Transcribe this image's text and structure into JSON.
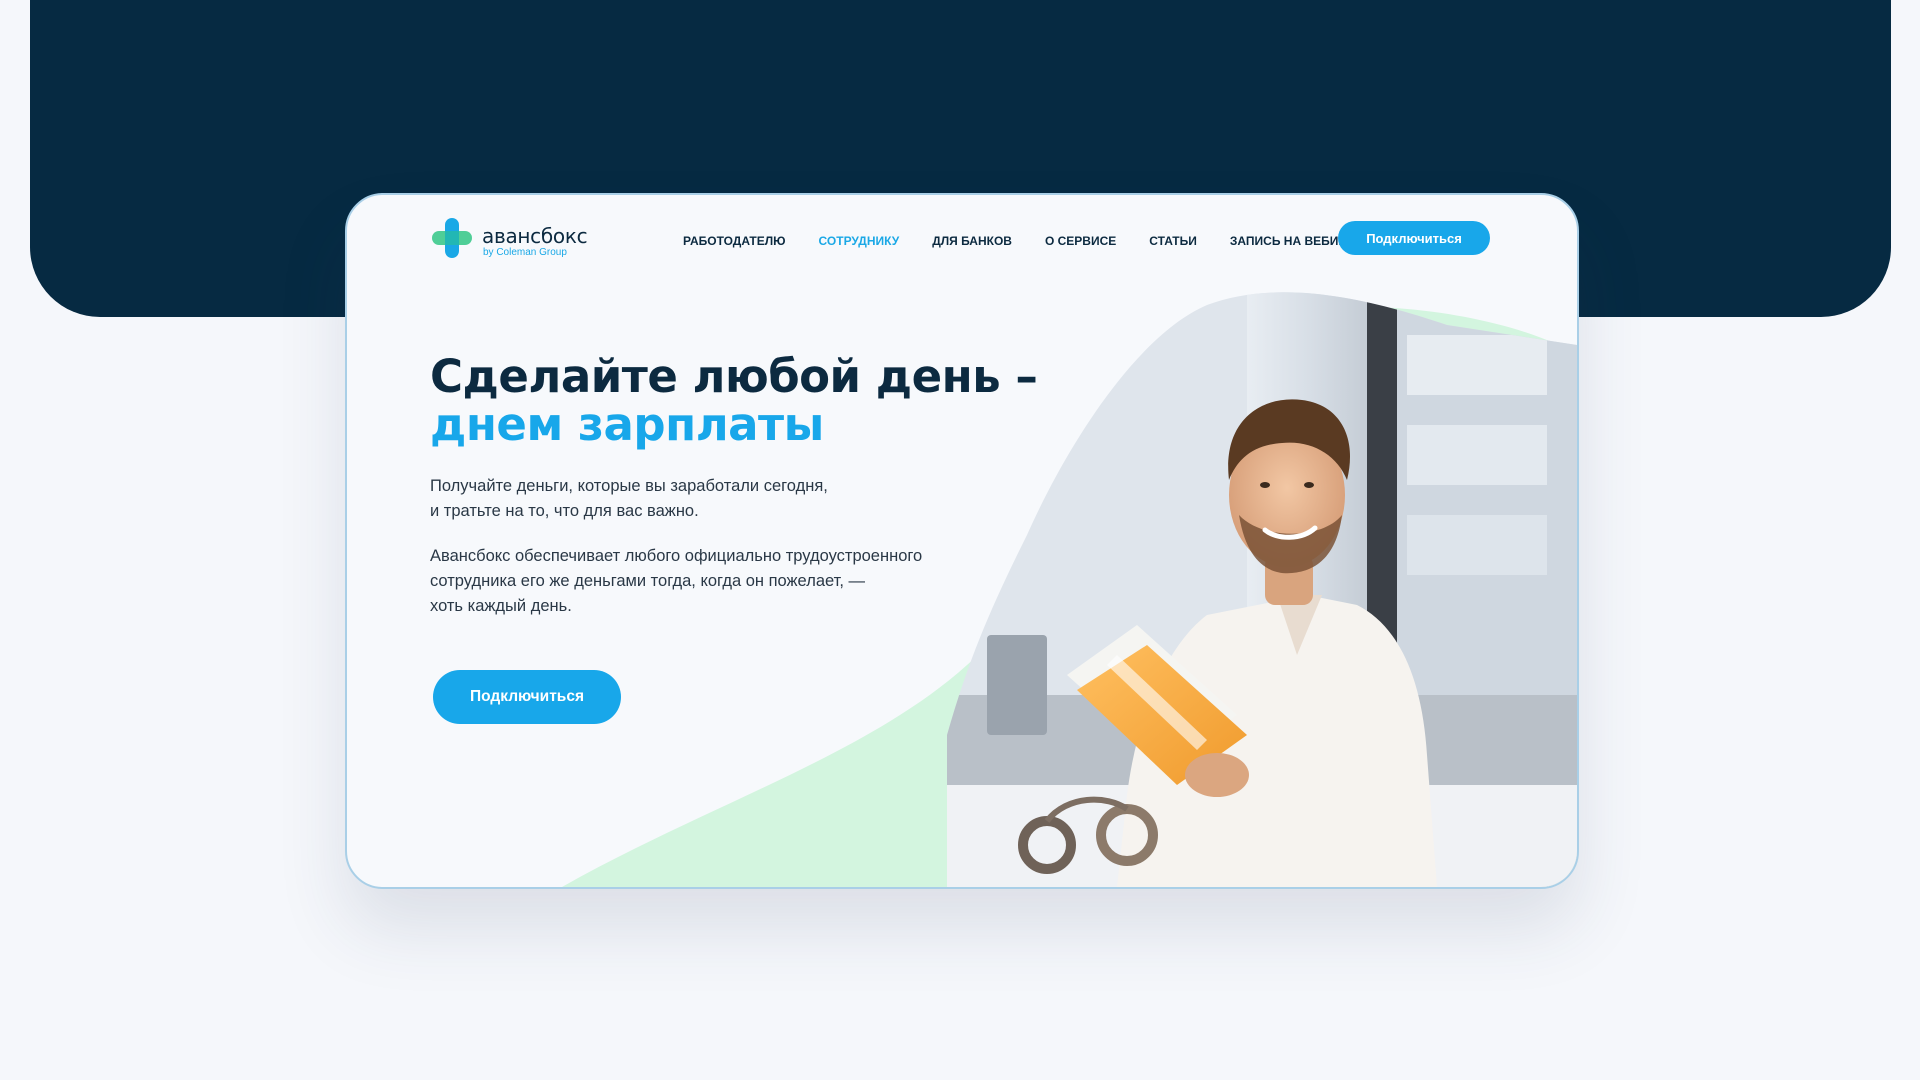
{
  "brand": {
    "name": "авансбокс",
    "byline": "by Coleman Group",
    "colors": {
      "dark_navy": "#062a42",
      "accent_blue": "#18a7ea",
      "mint": "#d3f5df",
      "logo_green": "#3cc98c"
    }
  },
  "nav": {
    "items": [
      {
        "label": "РАБОТОДАТЕЛЮ",
        "active": false
      },
      {
        "label": "СОТРУДНИКУ",
        "active": true
      },
      {
        "label": "ДЛЯ БАНКОВ",
        "active": false
      },
      {
        "label": "О СЕРВИСЕ",
        "active": false
      },
      {
        "label": "СТАТЬИ",
        "active": false
      },
      {
        "label": "ЗАПИСЬ НА ВЕБИНАР",
        "active": false
      }
    ],
    "cta_label": "Подключиться"
  },
  "hero": {
    "title_line1": "Сделайте любой день –",
    "title_line2": "днем зарплаты",
    "paragraph1": "Получайте деньги, которые вы заработали сегодня,\nи тратьте на то, что для вас важно.",
    "paragraph2": "Авансбокс обеспечивает любого официально трудоустроенного\nсотрудника его же деньгами тогда, когда он пожелает, —\nхоть каждый день.",
    "cta_label": "Подключиться",
    "image_subject": "smiling man in white shirt reading an open book at desk with headphones"
  }
}
